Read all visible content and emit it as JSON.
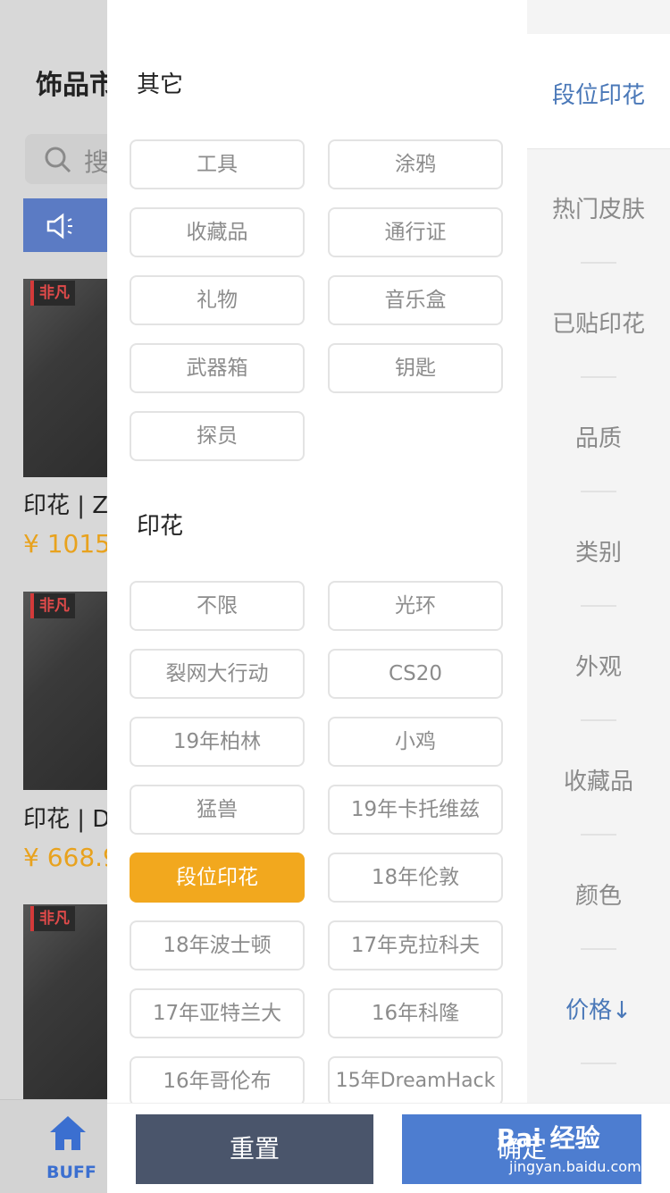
{
  "background": {
    "title": "饰品市",
    "search_placeholder": "搜",
    "cards": [
      {
        "badge": "非凡",
        "name": "印花 | Zy",
        "price": "¥ 1015"
      },
      {
        "badge": "非凡",
        "name": "印花 | Di",
        "price": "¥ 668.9"
      },
      {
        "badge": "非凡",
        "name": "",
        "price": ""
      }
    ],
    "bottom_nav_label": "BUFF",
    "notice_color": "#5b7bc4"
  },
  "filter": {
    "sections": [
      {
        "title": "其它",
        "options": [
          "工具",
          "涂鸦",
          "收藏品",
          "通行证",
          "礼物",
          "音乐盒",
          "武器箱",
          "钥匙",
          "探员"
        ]
      },
      {
        "title": "印花",
        "options": [
          "不限",
          "光环",
          "裂网大行动",
          "CS20",
          "19年柏林",
          "小鸡",
          "猛兽",
          "19年卡托维兹",
          "段位印花",
          "18年伦敦",
          "18年波士顿",
          "17年克拉科夫",
          "17年亚特兰大",
          "16年科隆",
          "16年哥伦布",
          "15年DreamHack"
        ],
        "selected": "段位印花"
      }
    ],
    "categories": [
      "段位印花",
      "热门皮肤",
      "已贴印花",
      "品质",
      "类别",
      "外观",
      "收藏品",
      "颜色",
      "价格↓"
    ],
    "selected_category": "段位印花",
    "accent_color": "#f2a81e"
  },
  "footer": {
    "reset_label": "重置",
    "confirm_label": "确定"
  },
  "watermark": {
    "brand": "Bai 经验",
    "url": "jingyan.baidu.com"
  }
}
